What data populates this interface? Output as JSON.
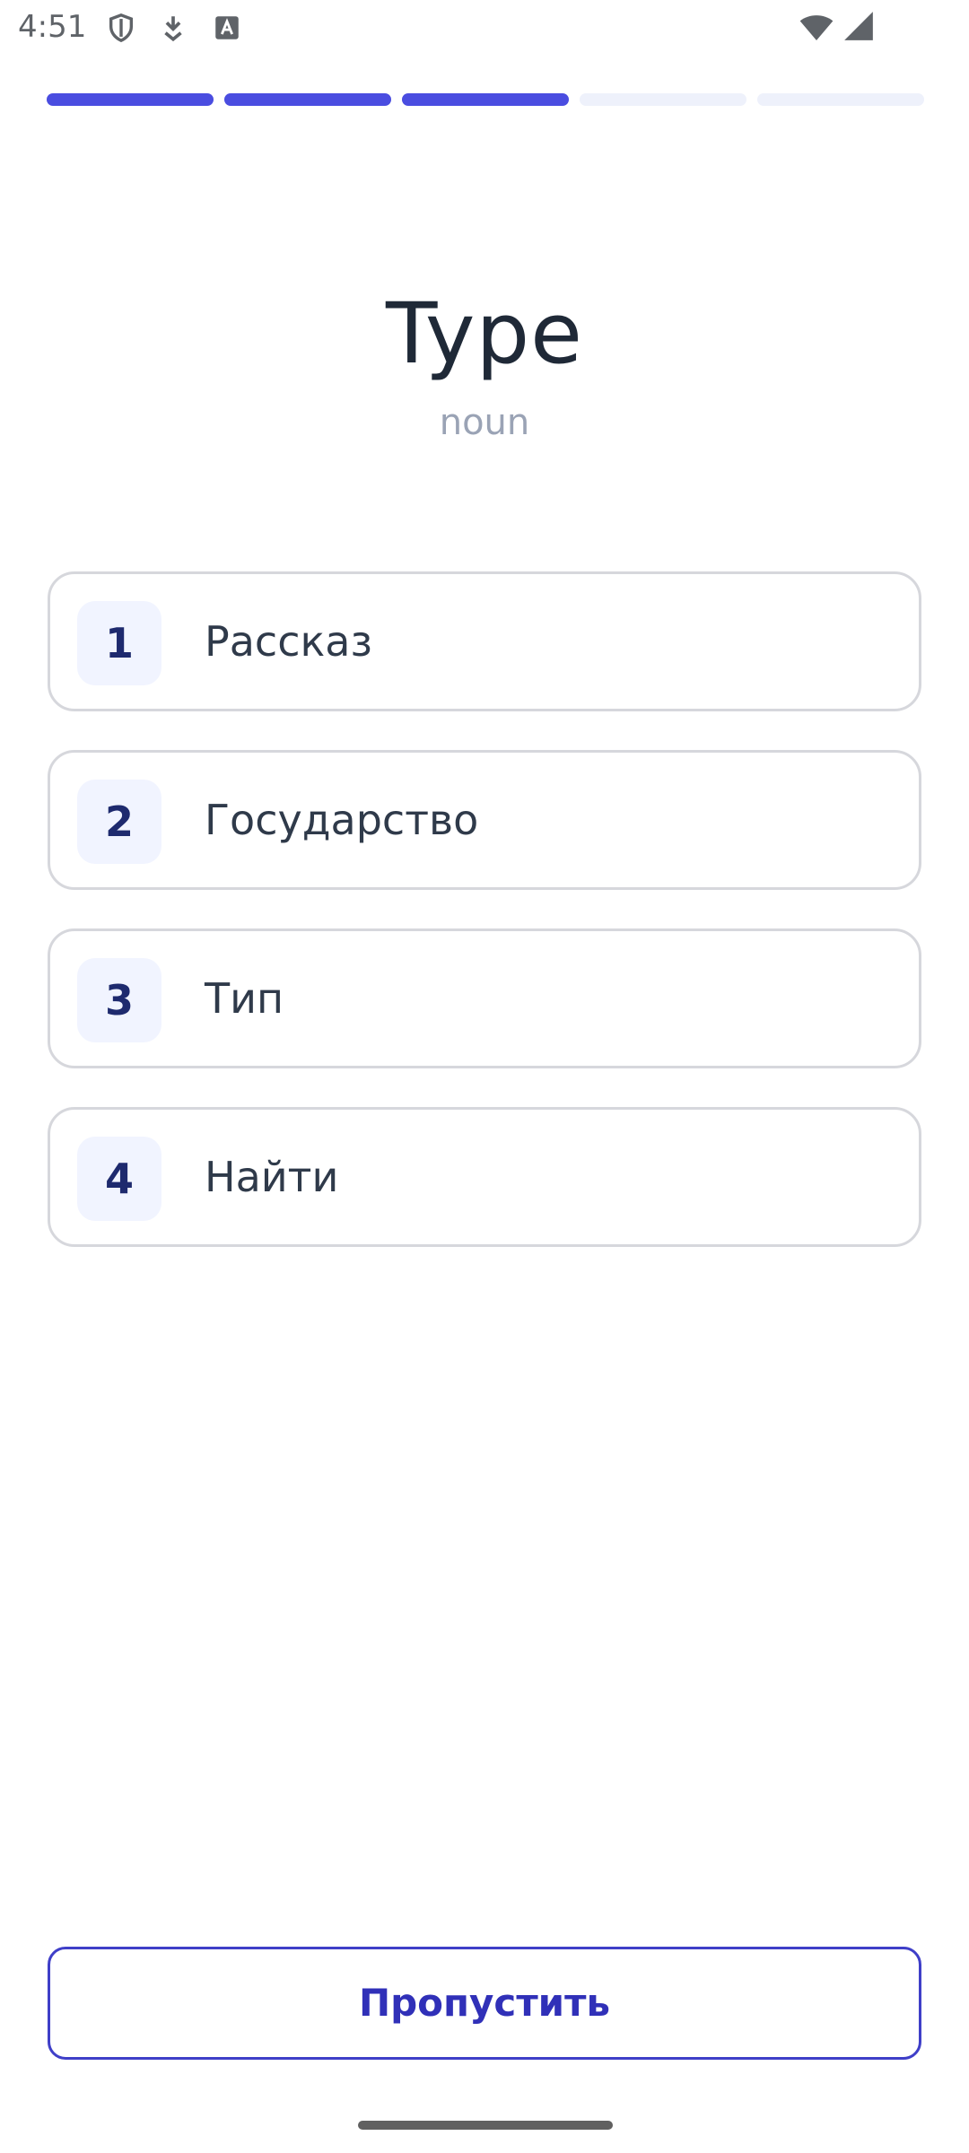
{
  "status_bar": {
    "time": "4:51",
    "icons": [
      "shield-icon",
      "download-icon",
      "keyboard-a-icon",
      "wifi-icon",
      "cellular-signal-icon"
    ]
  },
  "progress": {
    "total_steps": 5,
    "completed_steps": 3,
    "active_color": "#4a4de0",
    "inactive_color": "#eef1fb"
  },
  "card": {
    "word": "Type",
    "part_of_speech": "noun"
  },
  "options": [
    {
      "number": "1",
      "label": "Рассказ"
    },
    {
      "number": "2",
      "label": "Государство"
    },
    {
      "number": "3",
      "label": "Тип"
    },
    {
      "number": "4",
      "label": "Найти"
    }
  ],
  "skip_button": {
    "label": "Пропустить"
  }
}
